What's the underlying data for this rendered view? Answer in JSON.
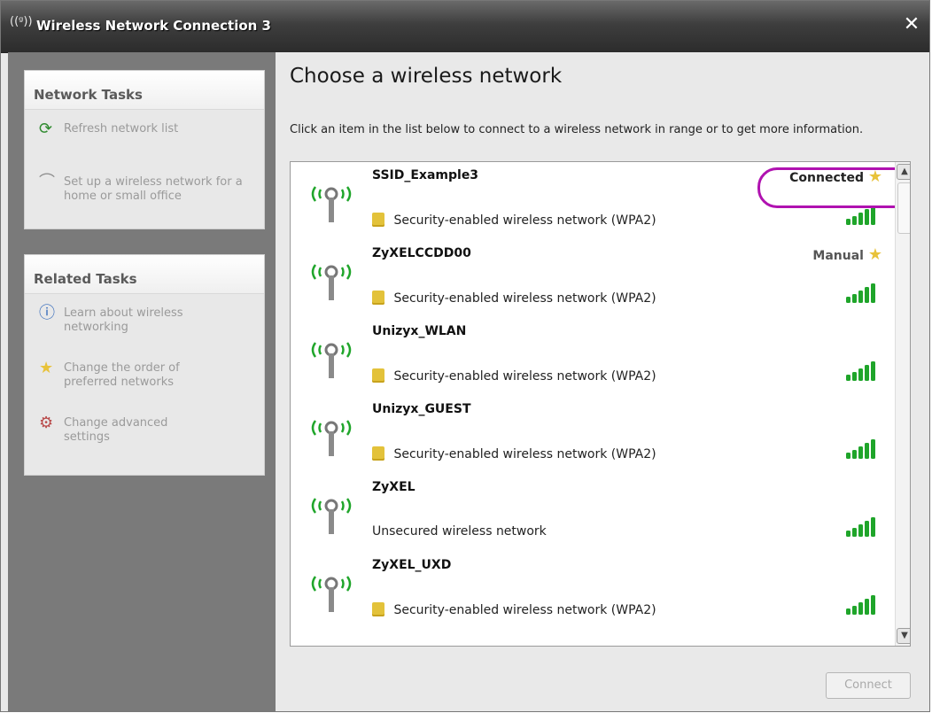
{
  "window": {
    "title": "Wireless Network Connection 3",
    "close_label": "✕"
  },
  "sidebar": {
    "network_tasks": {
      "header": "Network Tasks",
      "items": [
        {
          "label": "Refresh network list",
          "icon": "refresh-icon"
        },
        {
          "label": "Set up a wireless network for a home or small office",
          "icon": "wireless-setup-icon"
        }
      ]
    },
    "related_tasks": {
      "header": "Related Tasks",
      "items": [
        {
          "label": "Learn about wireless networking",
          "icon": "info-icon"
        },
        {
          "label": "Change the order of preferred networks",
          "icon": "star-icon"
        },
        {
          "label": "Change advanced settings",
          "icon": "settings-icon"
        }
      ]
    }
  },
  "main": {
    "heading": "Choose a wireless network",
    "instruction": "Click an item in the list below to connect to a wireless network in range or to get more information.",
    "networks": [
      {
        "ssid": "SSID_Example3",
        "status": "Connected",
        "security": "Security-enabled wireless network (WPA2)",
        "secured": true
      },
      {
        "ssid": "ZyXELCCDD00",
        "status": "Manual",
        "security": "Security-enabled wireless network (WPA2)",
        "secured": true
      },
      {
        "ssid": "Unizyx_WLAN",
        "status": "",
        "security": "Security-enabled wireless network (WPA2)",
        "secured": true
      },
      {
        "ssid": "Unizyx_GUEST",
        "status": "",
        "security": "Security-enabled wireless network (WPA2)",
        "secured": true
      },
      {
        "ssid": "ZyXEL",
        "status": "",
        "security": "Unsecured wireless network",
        "secured": false
      },
      {
        "ssid": "ZyXEL_UXD",
        "status": "",
        "security": "Security-enabled wireless network (WPA2)",
        "secured": true
      }
    ],
    "connect_label": "Connect"
  },
  "colors": {
    "signal_green": "#1fa52a",
    "highlight_magenta": "#b012b0",
    "star_gold": "#e8c23a"
  }
}
